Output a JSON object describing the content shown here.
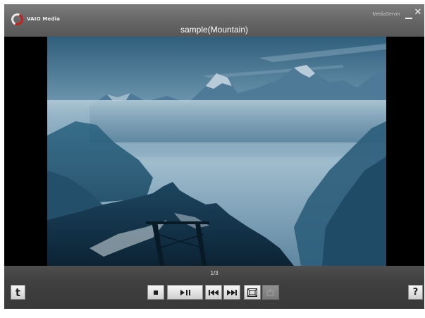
{
  "window": {
    "title": "sample(Mountain)",
    "logo_text": "VAIO Media",
    "mode_label": "MediaServer"
  },
  "titlebar_buttons": {
    "minimize_icon": "minimize-icon",
    "close_icon": "close-icon",
    "close_glyph": "✕"
  },
  "viewer": {
    "image_subject": "mountain-landscape"
  },
  "controls": {
    "page_counter": "1/3",
    "left_button_glyph": "t",
    "help_glyph": "?",
    "buttons": [
      {
        "name": "stop-button",
        "icon": "stop-icon"
      },
      {
        "name": "play-pause-button",
        "icon": "play-pause-icon"
      },
      {
        "name": "previous-button",
        "icon": "skip-previous-icon"
      },
      {
        "name": "next-button",
        "icon": "skip-next-icon"
      },
      {
        "name": "fullscreen-button",
        "icon": "fullscreen-icon"
      },
      {
        "name": "rotate-button",
        "icon": "rotate-icon",
        "disabled": true
      }
    ]
  },
  "colors": {
    "titlebar": "#686868",
    "control_bar": "#434343",
    "viewer_background": "#000000",
    "logo_accent": "#c81e1e"
  }
}
